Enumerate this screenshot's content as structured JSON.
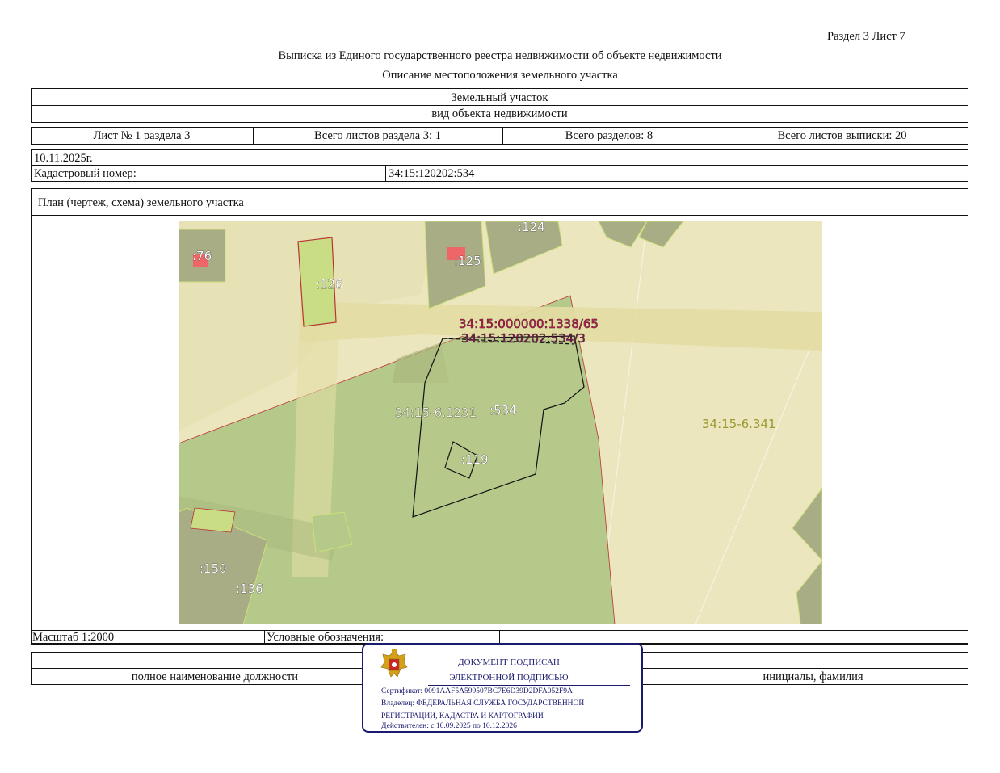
{
  "header": {
    "section_sheet": "Раздел 3    Лист 7",
    "title": "Выписка из Единого государственного реестра недвижимости об объекте недвижимости",
    "subtitle": "Описание местоположения земельного участка"
  },
  "object": {
    "type": "Земельный участок",
    "type_caption": "вид объекта недвижимости"
  },
  "sheet_info": {
    "sheet": "Лист № 1 раздела 3",
    "total_sheets_section": "Всего листов раздела 3: 1",
    "total_sections": "Всего разделов: 8",
    "total_sheets_extract": "Всего листов выписки: 20"
  },
  "date": "10.11.2025г.",
  "cadastral": {
    "label": "Кадастровый номер:",
    "value": "34:15:120202:534"
  },
  "plan_title": "План (чертеж, схема) земельного участка",
  "map_labels": {
    "p76": ":76",
    "p124": ":124",
    "p125": ":125",
    "p126": ":126",
    "p1338": "34:15:000000:1338/65",
    "p534_3": "34:15:120202:534/3",
    "zone1231": "34:15-6.1231",
    "p534": ":534",
    "zone341": "34:15-6.341",
    "p119": ":119",
    "p150": ":150",
    "p136": ":136"
  },
  "footer": {
    "scale": "Масштаб 1:2000",
    "legend": "Условные обозначения:",
    "position_caption": "полное наименование должности",
    "name_caption": "инициалы, фамилия"
  },
  "signature_stamp": {
    "line1": "ДОКУМЕНТ ПОДПИСАН",
    "line2": "ЭЛЕКТРОННОЙ ПОДПИСЬЮ",
    "certificate": "Сертификат: 0091AAF5A599507BC7E6D39D2DFA052F9A",
    "owner1": "Владелец: ФЕДЕРАЛЬНАЯ СЛУЖБА ГОСУДАРСТВЕННОЙ",
    "owner2": "РЕГИСТРАЦИИ, КАДАСТРА И КАРТОГРАФИИ",
    "validity": "Действителен: с 16.09.2025 по 10.12.2026"
  },
  "colors": {
    "map_bg": "#ece6bf",
    "zone_green": "#b5c98a",
    "road": "#e3dda3",
    "parcel_grey": "#a9ad86",
    "stamp_blue": "#1a1a6e"
  }
}
